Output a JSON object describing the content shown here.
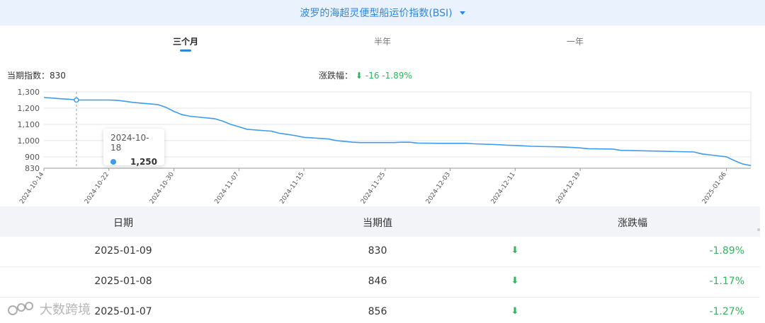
{
  "header": {
    "title": "波罗的海超灵便型船运价指数(BSI)"
  },
  "tabs": [
    {
      "label": "三个月",
      "active": true
    },
    {
      "label": "半年",
      "active": false
    },
    {
      "label": "一年",
      "active": false
    }
  ],
  "summary": {
    "current_label": "当期指数：",
    "current_value": "830",
    "change_label": "涨跌幅：",
    "change_value": "-16",
    "change_pct": "-1.89%"
  },
  "tooltip": {
    "date": "2024-10-18",
    "value": "1,250"
  },
  "colors": {
    "accent": "#2f86e0",
    "line": "#3d9bf0",
    "down": "#2db55d"
  },
  "chart_data": {
    "type": "line",
    "ylim": [
      830,
      1300
    ],
    "yticks": [
      "1,300",
      "1,200",
      "1,100",
      "1,000",
      "900",
      "830"
    ],
    "ytick_values": [
      1300,
      1200,
      1100,
      1000,
      900,
      830
    ],
    "xticks": [
      "2024-10-14",
      "2024-10-22",
      "2024-10-30",
      "2024-11-07",
      "2024-11-15",
      "2024-11-25",
      "2024-12-03",
      "2024-12-11",
      "2024-12-19",
      "2025-01-06"
    ],
    "x": [
      "2024-10-14",
      "2024-10-15",
      "2024-10-16",
      "2024-10-17",
      "2024-10-18",
      "2024-10-21",
      "2024-10-22",
      "2024-10-23",
      "2024-10-24",
      "2024-10-25",
      "2024-10-28",
      "2024-10-29",
      "2024-10-30",
      "2024-10-31",
      "2024-11-01",
      "2024-11-04",
      "2024-11-05",
      "2024-11-06",
      "2024-11-07",
      "2024-11-08",
      "2024-11-11",
      "2024-11-12",
      "2024-11-13",
      "2024-11-14",
      "2024-11-15",
      "2024-11-18",
      "2024-11-19",
      "2024-11-20",
      "2024-11-21",
      "2024-11-22",
      "2024-11-25",
      "2024-11-26",
      "2024-11-27",
      "2024-11-28",
      "2024-11-29",
      "2024-12-02",
      "2024-12-03",
      "2024-12-04",
      "2024-12-05",
      "2024-12-06",
      "2024-12-09",
      "2024-12-10",
      "2024-12-11",
      "2024-12-12",
      "2024-12-13",
      "2024-12-16",
      "2024-12-17",
      "2024-12-18",
      "2024-12-19",
      "2024-12-20",
      "2024-12-23",
      "2024-12-24",
      "2025-01-02",
      "2025-01-03",
      "2025-01-06",
      "2025-01-07",
      "2025-01-08",
      "2025-01-09"
    ],
    "series": [
      {
        "values": [
          1265,
          1262,
          1258,
          1255,
          1250,
          1250,
          1250,
          1248,
          1242,
          1235,
          1222,
          1205,
          1180,
          1160,
          1150,
          1135,
          1120,
          1100,
          1085,
          1070,
          1058,
          1045,
          1038,
          1030,
          1020,
          1010,
          1000,
          995,
          990,
          988,
          988,
          988,
          990,
          990,
          985,
          983,
          983,
          983,
          983,
          980,
          975,
          972,
          970,
          968,
          965,
          962,
          960,
          958,
          955,
          950,
          948,
          940,
          930,
          918,
          900,
          876,
          856,
          846,
          830
        ],
        "marker_date": "2024-10-18"
      }
    ]
  },
  "table": {
    "headers": [
      "日期",
      "当期值",
      "涨跌幅"
    ],
    "rows": [
      {
        "date": "2025-01-09",
        "value": "830",
        "arrow": "⬇",
        "change": "-1.89%"
      },
      {
        "date": "2025-01-08",
        "value": "846",
        "arrow": "⬇",
        "change": "-1.17%"
      },
      {
        "date": "2025-01-07",
        "value": "856",
        "arrow": "⬇",
        "change": "-1.27%"
      }
    ]
  },
  "watermark": {
    "text": "大数跨境"
  }
}
